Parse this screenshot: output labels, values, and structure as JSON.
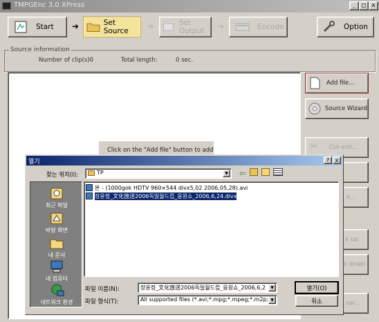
{
  "window": {
    "title": "TMPGEnc 3.0 XPress"
  },
  "toolbar": {
    "start": "Start",
    "set_source": "Set Source",
    "set_output": "Set Output",
    "encode": "Encode",
    "option": "Option"
  },
  "source_info": {
    "legend": "Source information",
    "clips_label": "Number of clip(s)0",
    "total_length_label": "Total length:",
    "total_length_value": "0 sec."
  },
  "list_area": {
    "hint": "Click on the \"Add file\" button to add"
  },
  "side_buttons": {
    "add_file": "Add file...",
    "source_wizard": "Source Wizard",
    "cut_edit": "Cut-edit...",
    "partial_edit": "e...",
    "move_up": "e up",
    "move_down": "e down",
    "last": "ear..."
  },
  "dialog": {
    "title": "열기",
    "look_in_label": "찾는 위치(I):",
    "look_in_value": "TP",
    "places": [
      "최근 파일",
      "바탕 화면",
      "내 문서",
      "내 컴퓨터",
      "네트워크 환경"
    ],
    "files": [
      "본 - (1000gok HDTV 960×544 divx5,02 2006,05,28).avi",
      "장윤정_文化放送2006독일월드컵_응원쇼_2006,6,24.divx"
    ],
    "filename_label": "파일 이름(N):",
    "filename_value": "장윤정_文化放送2006독일월드컵_응원쇼_2006,6,2",
    "filetype_label": "파일 형식(T):",
    "filetype_value": "All supported files (*.avi;*.mpg;*.mpeg;*.m2p;*",
    "open_button": "열기(O)",
    "cancel_button": "취소"
  }
}
